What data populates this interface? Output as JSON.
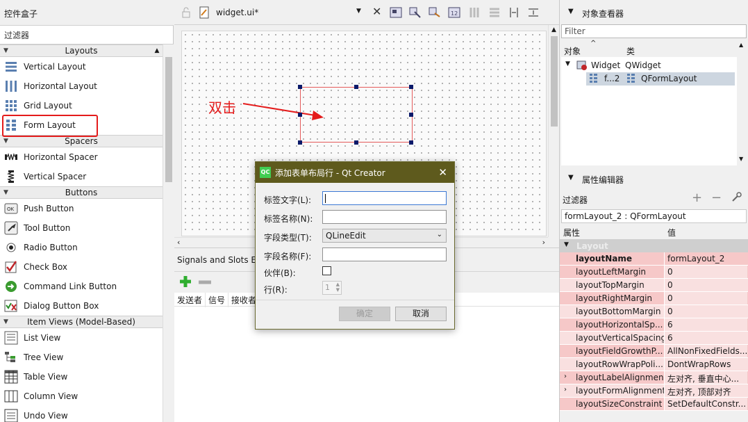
{
  "left_panel": {
    "title": "控件盒子",
    "filter_label": "过滤器",
    "categories": [
      {
        "name": "Layouts",
        "items": [
          "Vertical Layout",
          "Horizontal Layout",
          "Grid Layout",
          "Form Layout"
        ]
      },
      {
        "name": "Spacers",
        "items": [
          "Horizontal Spacer",
          "Vertical Spacer"
        ]
      },
      {
        "name": "Buttons",
        "items": [
          "Push Button",
          "Tool Button",
          "Radio Button",
          "Check Box",
          "Command Link Button",
          "Dialog Button Box"
        ]
      },
      {
        "name": "Item Views (Model-Based)",
        "items": [
          "List View",
          "Tree View",
          "Table View",
          "Column View",
          "Undo View"
        ]
      }
    ]
  },
  "editor": {
    "file_name": "widget.ui*",
    "annotation": "双击",
    "signals_tab": "Signals and Slots Ed",
    "signals_columns": [
      "发送者",
      "信号",
      "接收者"
    ]
  },
  "dialog": {
    "title": "添加表单布局行 - Qt Creator",
    "icon_text": "QC",
    "fields": {
      "label_text": "标签文字(L):",
      "label_name": "标签名称(N):",
      "field_type": "字段类型(T):",
      "field_type_value": "QLineEdit",
      "field_name": "字段名称(F):",
      "buddy": "伙伴(B):",
      "row": "行(R):",
      "row_value": "1"
    },
    "ok": "确定",
    "cancel": "取消"
  },
  "object_inspector": {
    "title": "对象查看器",
    "filter_placeholder": "Filter",
    "col_object": "对象",
    "col_class": "类",
    "rows": [
      {
        "object": "Widget",
        "class": "QWidget"
      },
      {
        "object": "f...2",
        "class": "QFormLayout"
      }
    ]
  },
  "property_editor": {
    "title": "属性编辑器",
    "filter_label": "过滤器",
    "object_line": "formLayout_2 : QFormLayout",
    "col_property": "属性",
    "col_value": "值",
    "group": "Layout",
    "properties": [
      {
        "name": "layoutName",
        "value": "formLayout_2"
      },
      {
        "name": "layoutLeftMargin",
        "value": "0"
      },
      {
        "name": "layoutTopMargin",
        "value": "0"
      },
      {
        "name": "layoutRightMargin",
        "value": "0"
      },
      {
        "name": "layoutBottomMargin",
        "value": "0"
      },
      {
        "name": "layoutHorizontalSp...",
        "value": "6"
      },
      {
        "name": "layoutVerticalSpacing",
        "value": "6"
      },
      {
        "name": "layoutFieldGrowthP...",
        "value": "AllNonFixedFields..."
      },
      {
        "name": "layoutRowWrapPoli...",
        "value": "DontWrapRows"
      },
      {
        "name": "layoutLabelAlignment",
        "value": "左对齐, 垂直中心..."
      },
      {
        "name": "layoutFormAlignment",
        "value": "左对齐, 顶部对齐"
      },
      {
        "name": "layoutSizeConstraint",
        "value": "SetDefaultConstr..."
      }
    ]
  },
  "colors": {
    "dialog_title_bg": "#5e5a1d",
    "highlight_red": "#e41b1b",
    "property_pink": "#f6c8c8",
    "selection": "#cde0f7"
  }
}
